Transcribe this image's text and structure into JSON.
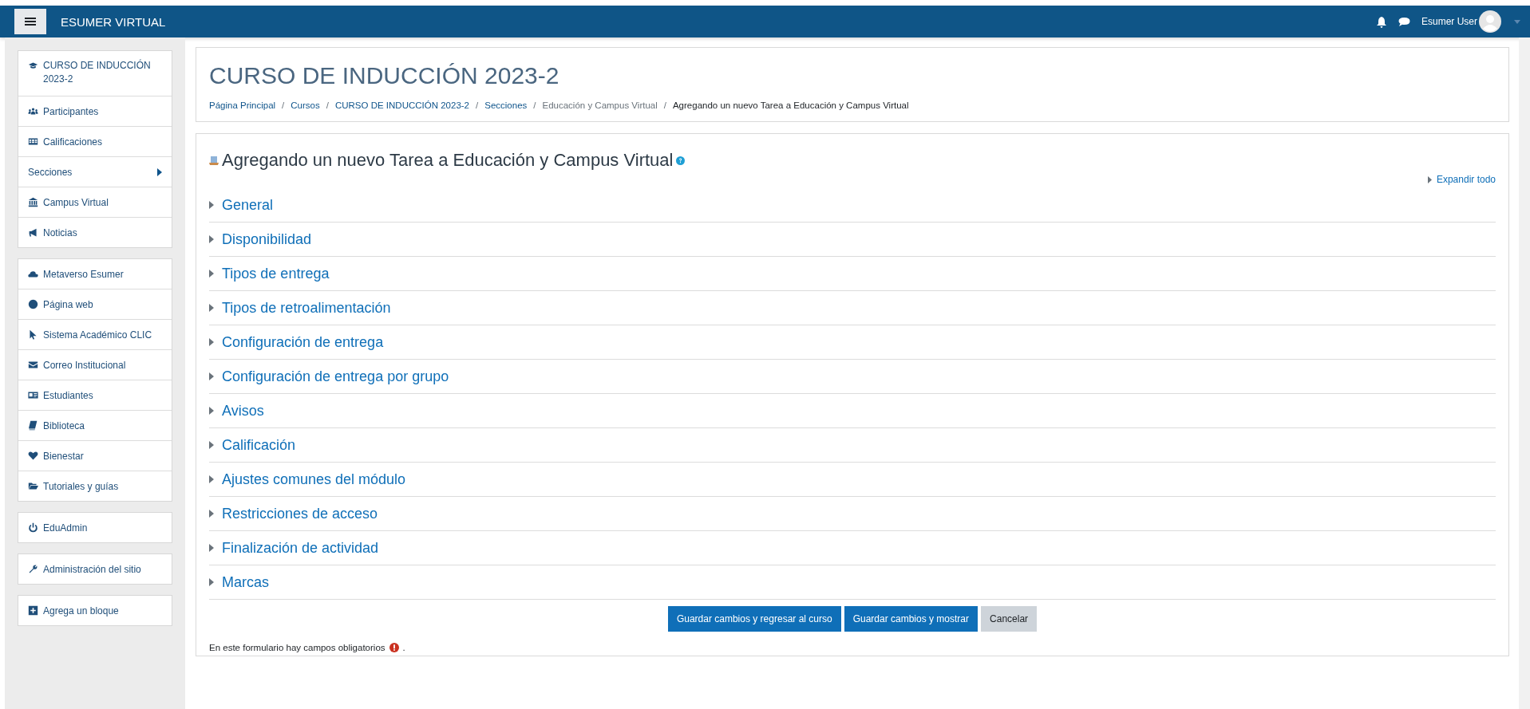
{
  "navbar": {
    "brand": "ESUMER VIRTUAL",
    "user": "Esumer User"
  },
  "sidebar": {
    "groups": [
      [
        {
          "label": "CURSO DE INDUCCIÓN 2023-2",
          "submenu": false
        },
        {
          "label": "Participantes",
          "submenu": false
        },
        {
          "label": "Calificaciones",
          "submenu": false
        },
        {
          "label": "Secciones",
          "submenu": true
        },
        {
          "label": "Campus Virtual",
          "submenu": false
        },
        {
          "label": "Noticias",
          "submenu": false
        }
      ],
      [
        {
          "label": "Metaverso Esumer",
          "submenu": false
        },
        {
          "label": "Página web",
          "submenu": false
        },
        {
          "label": "Sistema Académico CLIC",
          "submenu": false
        },
        {
          "label": "Correo Institucional",
          "submenu": false
        },
        {
          "label": "Estudiantes",
          "submenu": false
        },
        {
          "label": "Biblioteca",
          "submenu": false
        },
        {
          "label": "Bienestar",
          "submenu": false
        },
        {
          "label": "Tutoriales y guías",
          "submenu": false
        }
      ],
      [
        {
          "label": "EduAdmin",
          "submenu": false
        }
      ],
      [
        {
          "label": "Administración del sitio",
          "submenu": false
        }
      ],
      [
        {
          "label": "Agrega un bloque",
          "submenu": false
        }
      ]
    ]
  },
  "header": {
    "title": "CURSO DE INDUCCIÓN 2023-2",
    "separator": "/",
    "breadcrumb": [
      {
        "label": "Página Principal",
        "kind": "link"
      },
      {
        "label": "Cursos",
        "kind": "link"
      },
      {
        "label": "CURSO DE INDUCCIÓN 2023-2",
        "kind": "link"
      },
      {
        "label": "Secciones",
        "kind": "link"
      },
      {
        "label": "Educación y Campus Virtual",
        "kind": "muted"
      },
      {
        "label": "Agregando un nuevo Tarea a Educación y Campus Virtual",
        "kind": "current"
      }
    ]
  },
  "form": {
    "heading": "Agregando un nuevo Tarea a Educación y Campus Virtual",
    "expand_all": "Expandir todo",
    "sections": [
      {
        "label": "General",
        "expanded": false
      },
      {
        "label": "Disponibilidad",
        "expanded": false
      },
      {
        "label": "Tipos de entrega",
        "expanded": false
      },
      {
        "label": "Tipos de retroalimentación",
        "expanded": false
      },
      {
        "label": "Configuración de entrega",
        "expanded": false
      },
      {
        "label": "Configuración de entrega por grupo",
        "expanded": false
      },
      {
        "label": "Avisos",
        "expanded": false
      },
      {
        "label": "Calificación",
        "expanded": false
      },
      {
        "label": "Ajustes comunes del módulo",
        "expanded": false
      },
      {
        "label": "Restricciones de acceso",
        "expanded": false
      },
      {
        "label": "Finalización de actividad",
        "expanded": false
      },
      {
        "label": "Marcas",
        "expanded": false
      }
    ],
    "buttons": [
      {
        "label": "Guardar cambios y regresar al curso",
        "kind": "primary"
      },
      {
        "label": "Guardar cambios y mostrar",
        "kind": "primary"
      },
      {
        "label": "Cancelar",
        "kind": "secondary"
      }
    ],
    "required_note": "En este formulario hay campos obligatorios",
    "required_suffix": "."
  }
}
